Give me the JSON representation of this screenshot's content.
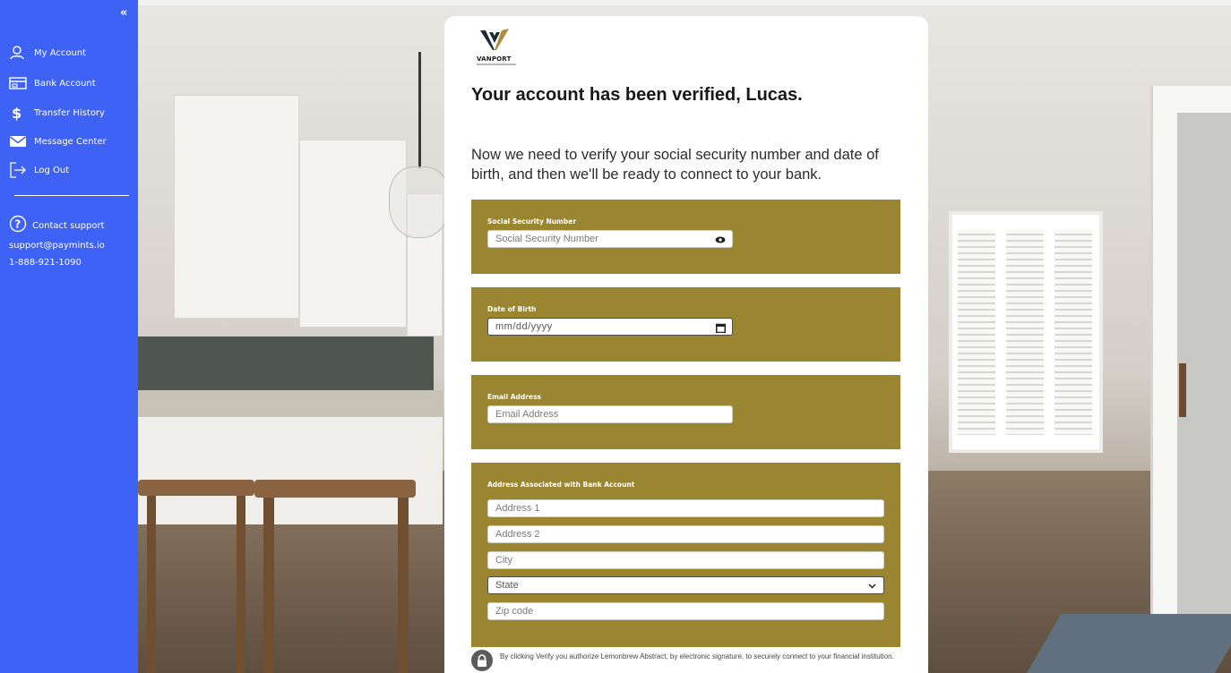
{
  "sidebar": {
    "collapse": "«",
    "items": [
      {
        "label": "My Account",
        "icon": "user-icon"
      },
      {
        "label": "Bank Account",
        "icon": "bank-icon"
      },
      {
        "label": "Transfer History",
        "icon": "dollar-icon"
      },
      {
        "label": "Message Center",
        "icon": "envelope-icon"
      },
      {
        "label": "Log Out",
        "icon": "logout-icon"
      }
    ],
    "contact": {
      "label": "Contact support",
      "email": "support@paymints.io",
      "phone": "1-888-921-1090"
    },
    "bg_color": "#3d62f5"
  },
  "card": {
    "logo_text": "VANPORT",
    "headline": "Your account has been verified, Lucas.",
    "subhead": "Now we need to verify your social security number and date of birth, and then we'll be ready to connect to your bank.",
    "section_color": "#9a8530",
    "ssn": {
      "label": "Social Security Number",
      "placeholder": "Social Security Number"
    },
    "dob": {
      "label": "Date of Birth",
      "placeholder": "mm/dd/yyyy"
    },
    "email": {
      "label": "Email Address",
      "placeholder": "Email Address"
    },
    "address": {
      "label": "Address Associated with Bank Account",
      "address1": "Address 1",
      "address2": "Address 2",
      "city": "City",
      "state": "State",
      "zip": "Zip code"
    },
    "consent": "By clicking Verify you authorize Lemonbrew Abstract, by electronic signature, to securely connect to your financial institution."
  }
}
